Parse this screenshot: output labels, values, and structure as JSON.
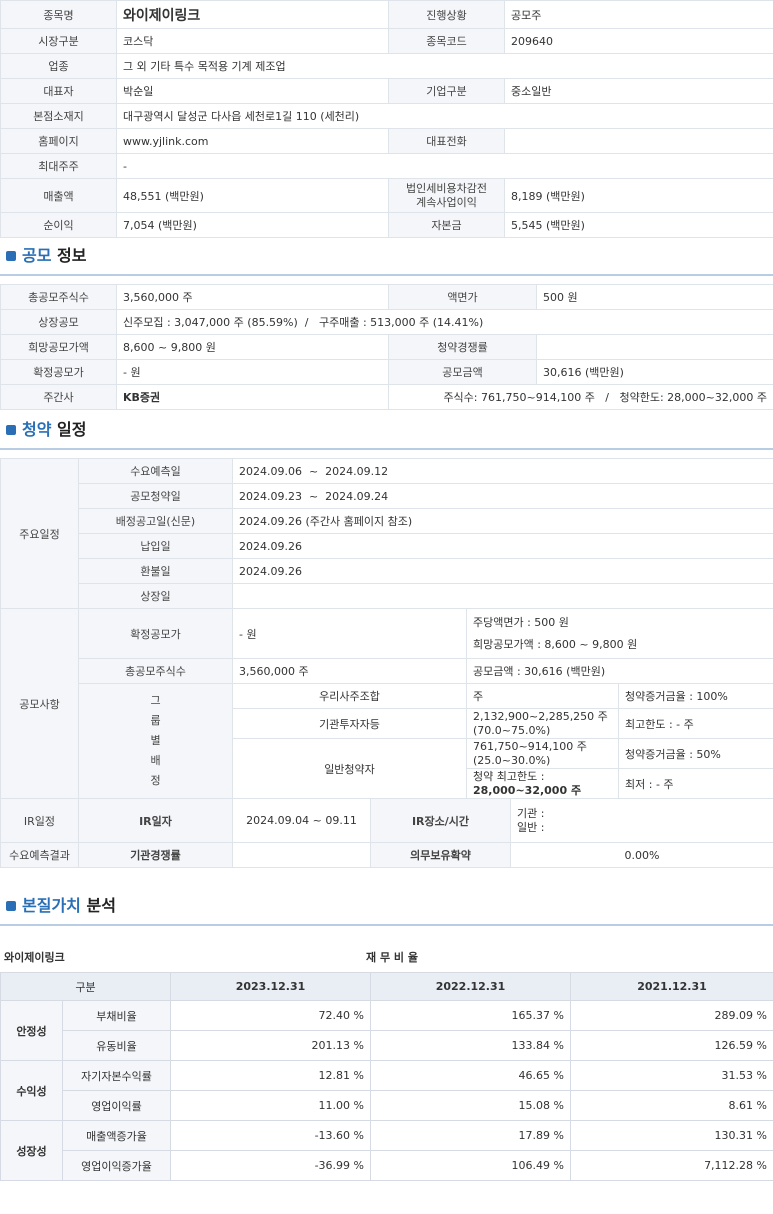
{
  "company_info": {
    "rows": [
      {
        "l1": "종목명",
        "v1": "와이제이링크",
        "l2": "진행상황",
        "v2": "공모주"
      },
      {
        "l1": "시장구분",
        "v1": "코스닥",
        "l2": "종목코드",
        "v2": "209640"
      },
      {
        "l1": "업종",
        "v1": "그 외 기타 특수 목적용 기계 제조업"
      },
      {
        "l1": "대표자",
        "v1": "박순일",
        "l2": "기업구분",
        "v2": "중소일반"
      },
      {
        "l1": "본점소재지",
        "v1": "대구광역시 달성군 다사읍 세천로1길 110 (세천리)"
      },
      {
        "l1": "홈페이지",
        "v1": "www.yjlink.com",
        "l2": "대표전화",
        "v2": ""
      },
      {
        "l1": "최대주주",
        "v1": "-"
      },
      {
        "l1": "매출액",
        "v1": "48,551 (백만원)",
        "l2": "법인세비용차감전\n계속사업이익",
        "v2": "8,189 (백만원)"
      },
      {
        "l1": "순이익",
        "v1": "7,054 (백만원)",
        "l2": "자본금",
        "v2": "5,545 (백만원)"
      }
    ]
  },
  "section_offering": {
    "title_a": "공모",
    "title_b": "정보"
  },
  "offering": {
    "total_shares_label": "총공모주식수",
    "total_shares": "3,560,000 주",
    "par_label": "액면가",
    "par": "500 원",
    "listing_label": "상장공모",
    "listing": "신주모집 : 3,047,000 주 (85.59%)  /   구주매출 : 513,000 주 (14.41%)",
    "hope_label": "희망공모가액",
    "hope": "8,600 ~ 9,800 원",
    "compete_label": "청약경쟁률",
    "compete": "",
    "final_label": "확정공모가",
    "final": "- 원",
    "amount_label": "공모금액",
    "amount": "30,616 (백만원)",
    "underwriter_label": "주간사",
    "underwriter": "KB증권",
    "underwriter_detail": "주식수: 761,750~914,100 주   /   청약한도: 28,000~32,000 주"
  },
  "section_subscription": {
    "title_a": "청약",
    "title_b": "일정"
  },
  "schedule": {
    "main_label": "주요일정",
    "items": [
      {
        "l": "수요예측일",
        "v": "2024.09.06  ~  2024.09.12"
      },
      {
        "l": "공모청약일",
        "v": "2024.09.23  ~  2024.09.24"
      },
      {
        "l": "배정공고일(신문)",
        "v": "2024.09.26 (주간사 홈페이지 참조)"
      },
      {
        "l": "납입일",
        "v": "2024.09.26"
      },
      {
        "l": "환불일",
        "v": "2024.09.26"
      },
      {
        "l": "상장일",
        "v": ""
      }
    ],
    "offer_label": "공모사항",
    "final_label": "확정공모가",
    "final": "- 원",
    "par_text": "주당액면가 :  500 원",
    "hope_text": "희망공모가액 :  8,600 ~ 9,800 원",
    "total_label": "총공모주식수",
    "total": "3,560,000 주",
    "amount_text": "공모금액 : 30,616 (백만원)",
    "group_label": "그\n룹\n별\n배\n정",
    "g1_name": "우리사주조합",
    "g1_val": "주",
    "g1_note": "청약증거금율 : 100%",
    "g2_name": "기관투자자등",
    "g2_val": "2,132,900~2,285,250 주\n(70.0~75.0%)",
    "g2_note": "최고한도 :  - 주",
    "g3_name": "일반청약자",
    "g3_val": "761,750~914,100 주\n(25.0~30.0%)",
    "g3_note": "청약증거금율 : 50%",
    "g3_limit_label": "청약 최고한도 :",
    "g3_limit": "28,000~32,000 주",
    "g3_min": "최저 :  - 주",
    "ir_label": "IR일정",
    "ir_date_label": "IR일자",
    "ir_date": "2024.09.04 ~ 09.11",
    "ir_place_label": "IR장소/시간",
    "ir_place": "기관 :\n일반 :",
    "demand_label": "수요예측결과",
    "inst_label": "기관경쟁률",
    "inst": "",
    "lock_label": "의무보유확약",
    "lock": "0.00%"
  },
  "section_value": {
    "title_a": "본질가치",
    "title_b": "분석"
  },
  "financial": {
    "company": "와이제이링크",
    "caption": "재 무 비 율",
    "headers": [
      "구분",
      "2023.12.31",
      "2022.12.31",
      "2021.12.31"
    ],
    "groups": [
      {
        "name": "안정성",
        "rows": [
          {
            "item": "부채비율",
            "vals": [
              "72.40 %",
              "165.37 %",
              "289.09 %"
            ]
          },
          {
            "item": "유동비율",
            "vals": [
              "201.13 %",
              "133.84 %",
              "126.59 %"
            ]
          }
        ]
      },
      {
        "name": "수익성",
        "rows": [
          {
            "item": "자기자본수익률",
            "vals": [
              "12.81 %",
              "46.65 %",
              "31.53 %"
            ]
          },
          {
            "item": "영업이익률",
            "vals": [
              "11.00 %",
              "15.08 %",
              "8.61 %"
            ]
          }
        ]
      },
      {
        "name": "성장성",
        "rows": [
          {
            "item": "매출액증가율",
            "vals": [
              "-13.60 %",
              "17.89 %",
              "130.31 %"
            ]
          },
          {
            "item": "영업이익증가율",
            "vals": [
              "-36.99 %",
              "106.49 %",
              "7,112.28 %"
            ]
          }
        ]
      }
    ]
  }
}
